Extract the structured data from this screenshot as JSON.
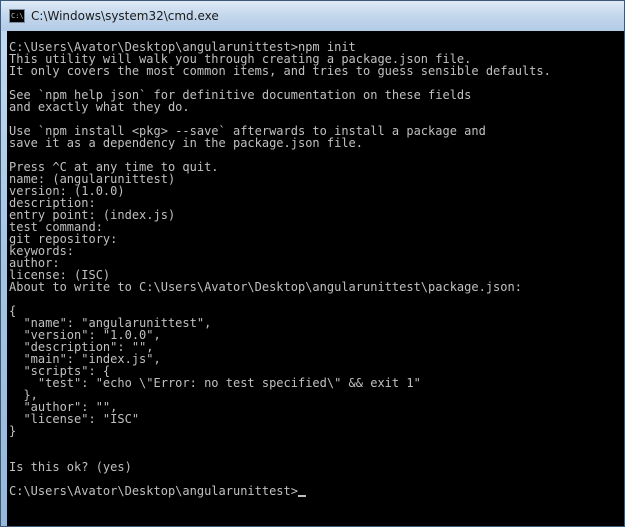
{
  "window": {
    "title": "C:\\Windows\\system32\\cmd.exe",
    "icon": "cmd-icon",
    "icon_text": "C:\\."
  },
  "console": {
    "lines": [
      "C:\\Users\\Avator\\Desktop\\angularunittest>npm init",
      "This utility will walk you through creating a package.json file.",
      "It only covers the most common items, and tries to guess sensible defaults.",
      "",
      "See `npm help json` for definitive documentation on these fields",
      "and exactly what they do.",
      "",
      "Use `npm install <pkg> --save` afterwards to install a package and",
      "save it as a dependency in the package.json file.",
      "",
      "Press ^C at any time to quit.",
      "name: (angularunittest)",
      "version: (1.0.0)",
      "description:",
      "entry point: (index.js)",
      "test command:",
      "git repository:",
      "keywords:",
      "author:",
      "license: (ISC)",
      "About to write to C:\\Users\\Avator\\Desktop\\angularunittest\\package.json:",
      "",
      "{",
      "  \"name\": \"angularunittest\",",
      "  \"version\": \"1.0.0\",",
      "  \"description\": \"\",",
      "  \"main\": \"index.js\",",
      "  \"scripts\": {",
      "    \"test\": \"echo \\\"Error: no test specified\\\" && exit 1\"",
      "  },",
      "  \"author\": \"\",",
      "  \"license\": \"ISC\"",
      "}",
      "",
      "",
      "Is this ok? (yes)",
      "",
      "C:\\Users\\Avator\\Desktop\\angularunittest>"
    ]
  },
  "colors": {
    "console_bg": "#000000",
    "console_fg": "#c0c0c0"
  }
}
